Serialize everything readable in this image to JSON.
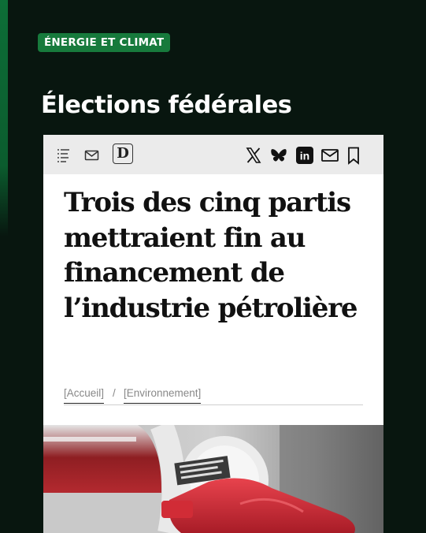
{
  "badge": {
    "label": "ÉNERGIE ET CLIMAT"
  },
  "section": {
    "title": "Élections fédérales"
  },
  "toolbar": {
    "menu_icon": "menu-list-icon",
    "mail_icon": "mail-icon",
    "logo_letter": "D",
    "share_icons": [
      "x-icon",
      "bluesky-icon",
      "linkedin-icon",
      "mail-icon",
      "bookmark-icon"
    ],
    "linkedin_text": "in"
  },
  "article": {
    "headline": "Trois des cinq partis mettraient fin au financement de l’industrie pétrolière",
    "breadcrumb": [
      "[Accueil]",
      "[Environnement]"
    ],
    "breadcrumb_separator": "/"
  },
  "photo": {
    "subject": "fuel-nozzle-in-car-tank"
  },
  "colors": {
    "background": "#08160f",
    "badge": "#177a3c",
    "accent": "#0d6e37",
    "toolbar": "#ebebeb",
    "nozzle": "#cf2a37"
  }
}
